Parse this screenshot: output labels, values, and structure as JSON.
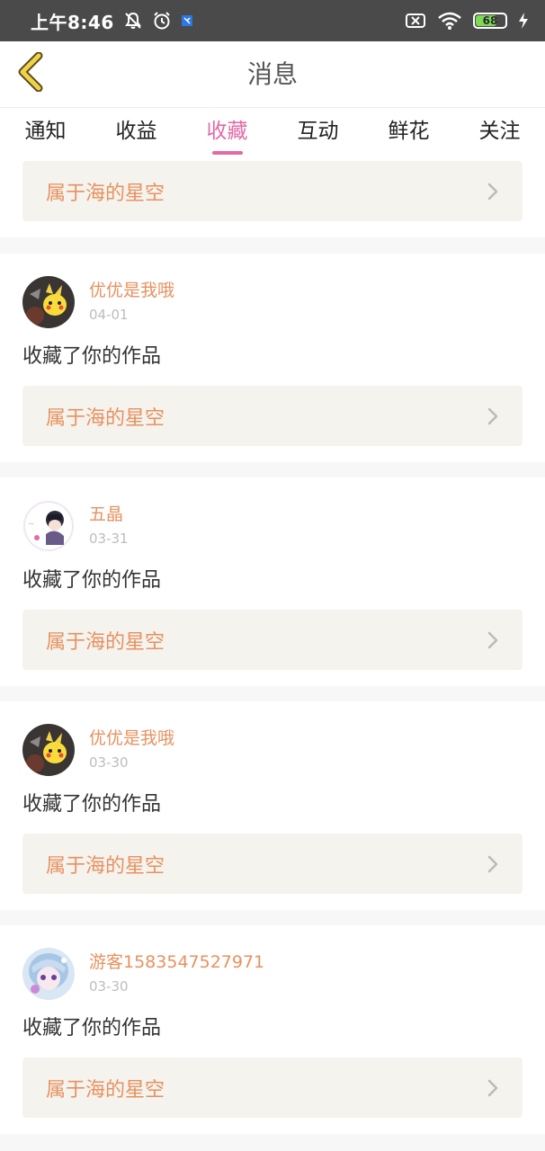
{
  "status_bar": {
    "time": "上午8:46",
    "battery": "68",
    "icons": [
      "notifications-off-icon",
      "alarm-icon",
      "app-notification-icon",
      "sim-off-icon",
      "wifi-icon",
      "battery-icon",
      "charging-icon"
    ]
  },
  "header": {
    "title": "消息",
    "back_icon": "chevron-left-icon"
  },
  "tabs": [
    {
      "label": "通知",
      "active": false
    },
    {
      "label": "收益",
      "active": false
    },
    {
      "label": "收藏",
      "active": true
    },
    {
      "label": "互动",
      "active": false
    },
    {
      "label": "鲜花",
      "active": false
    },
    {
      "label": "关注",
      "active": false
    }
  ],
  "colors": {
    "accent_pink": "#e36aa7",
    "username_orange": "#e8915f",
    "work_card_bg": "#f4f3ed",
    "status_bar_bg": "#4a4a4a"
  },
  "partial_item": {
    "work_title": "属于海的星空"
  },
  "items": [
    {
      "username": "优优是我哦",
      "date": "04-01",
      "message": "收藏了你的作品",
      "work_title": "属于海的星空",
      "avatar": "pikachu-avatar"
    },
    {
      "username": "五晶",
      "date": "03-31",
      "message": "收藏了你的作品",
      "work_title": "属于海的星空",
      "avatar": "anime-character-avatar"
    },
    {
      "username": "优优是我哦",
      "date": "03-30",
      "message": "收藏了你的作品",
      "work_title": "属于海的星空",
      "avatar": "pikachu-avatar"
    },
    {
      "username": "游客1583547527971",
      "date": "03-30",
      "message": "收藏了你的作品",
      "work_title": "属于海的星空",
      "avatar": "anime-girl-avatar"
    }
  ]
}
